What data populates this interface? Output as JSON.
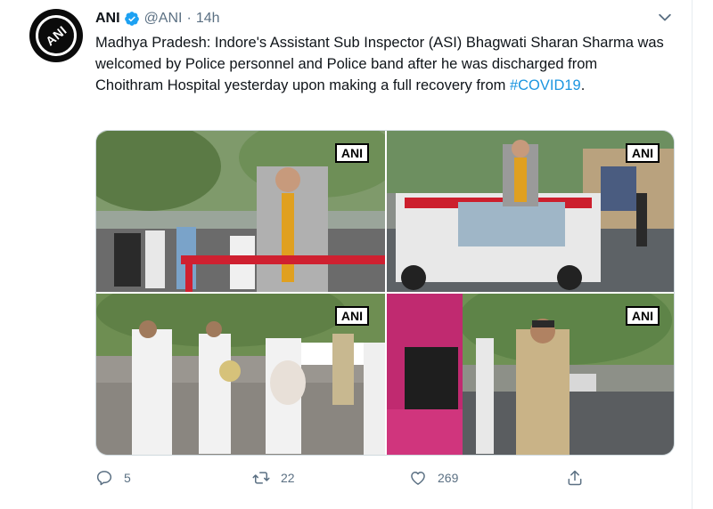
{
  "author": {
    "name": "ANI",
    "handle": "@ANI",
    "separator": "·",
    "time": "14h",
    "avatar_text": "ANI"
  },
  "tweet": {
    "text_main": "Madhya Pradesh: Indore's Assistant Sub Inspector (ASI) Bhagwati Sharan Sharma was welcomed by Police personnel and Police band after he was discharged from Choithram Hospital yesterday upon making a full recovery from ",
    "hashtag": "#COVID19",
    "text_end": "."
  },
  "media": {
    "watermark": "ANI"
  },
  "actions": {
    "replies": "5",
    "retweets": "22",
    "likes": "269"
  },
  "colors": {
    "accent": "#1b95e0",
    "muted": "#5b7083"
  },
  "icons": [
    "verified-badge-icon",
    "caret-down-icon",
    "reply-icon",
    "retweet-icon",
    "like-icon",
    "share-icon"
  ]
}
